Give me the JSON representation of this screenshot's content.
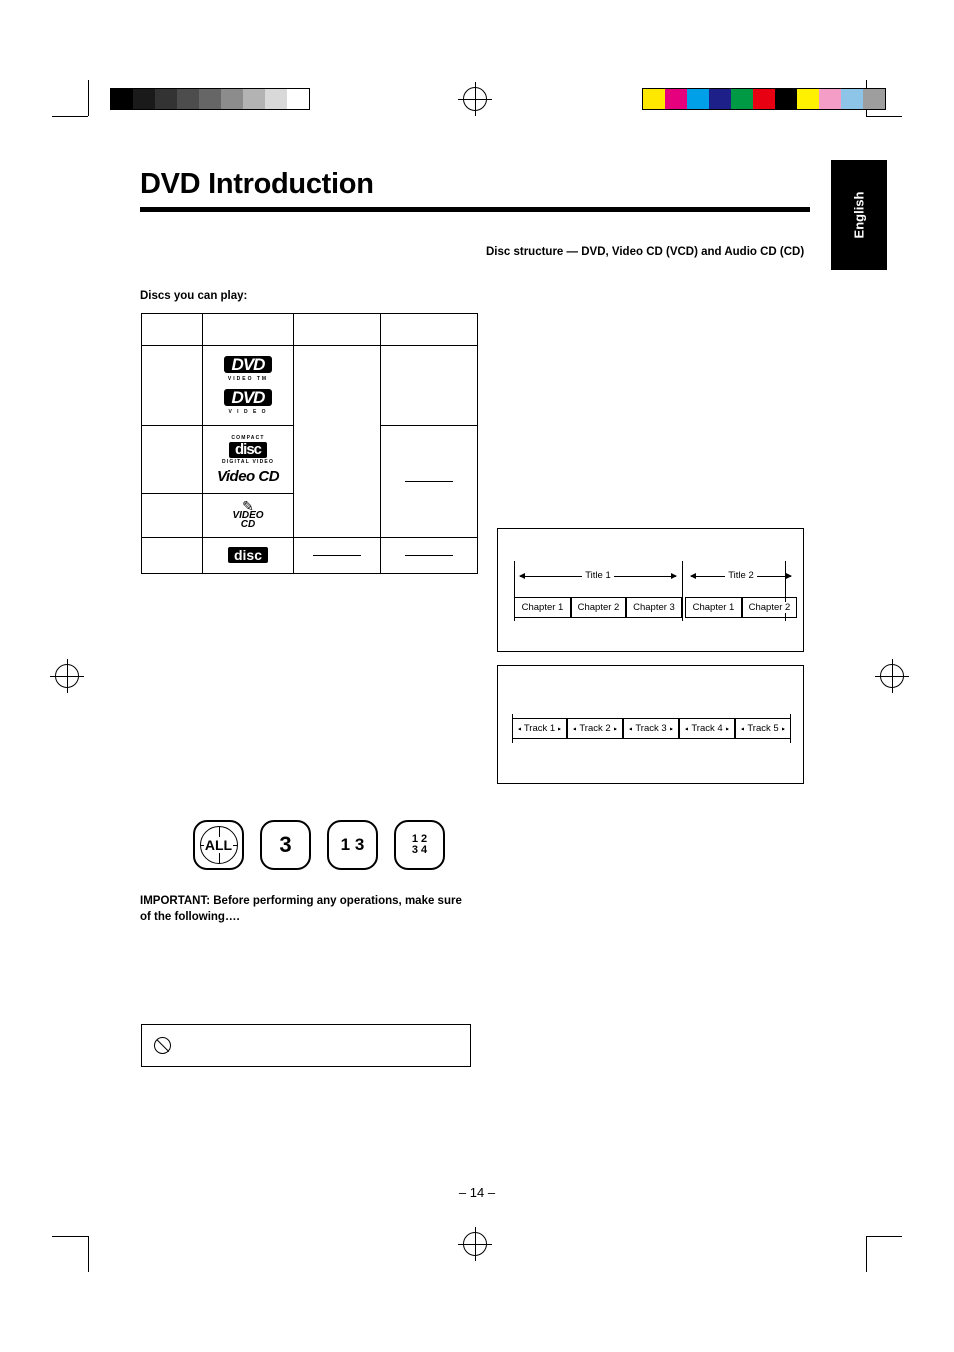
{
  "document": {
    "title": "DVD Introduction",
    "language_tab": "English",
    "page_number": "– 14 –"
  },
  "left_column": {
    "discs_heading": "Discs you can play:",
    "disc_table": {
      "rows": [
        {
          "logos": [
            "DVD",
            "DVD"
          ],
          "logo_sub": [
            "VIDEO TM",
            "V I D E O"
          ]
        },
        {
          "logos": [
            "COMPACT disc DIGITAL VIDEO",
            "Video CD"
          ]
        },
        {
          "logos": [
            "VIDEO CD"
          ]
        },
        {
          "logos": [
            "disc"
          ]
        }
      ]
    },
    "region_marks": [
      {
        "name": "region-all",
        "label": "ALL"
      },
      {
        "name": "region-3",
        "label": "3"
      },
      {
        "name": "region-1-3",
        "label": "1 3"
      },
      {
        "name": "region-1234",
        "label_top": "1 2",
        "label_bottom": "3 4"
      }
    ],
    "important_note": "IMPORTANT:  Before performing any operations, make sure of the following….",
    "note_box_icon": "prohibited-icon"
  },
  "right_column": {
    "structure_heading": "Disc structure — DVD, Video CD (VCD) and Audio CD (CD)",
    "dvd_diagram": {
      "name": "dvd-structure-diagram",
      "titles": [
        "Title 1",
        "Title 2"
      ],
      "chapters_title1": [
        "Chapter 1",
        "Chapter 2",
        "Chapter 3"
      ],
      "chapters_title2": [
        "Chapter 1",
        "Chapter 2"
      ]
    },
    "cd_diagram": {
      "name": "cd-structure-diagram",
      "tracks": [
        "Track 1",
        "Track 2",
        "Track 3",
        "Track 4",
        "Track 5"
      ]
    }
  },
  "print_marks": {
    "grayscale_bar": [
      "#000000",
      "#1a1a1a",
      "#333333",
      "#4d4d4d",
      "#666666",
      "#8c8c8c",
      "#b3b3b3",
      "#d9d9d9",
      "#ffffff"
    ],
    "color_bar": [
      "#ffe800",
      "#e6007e",
      "#00a0e9",
      "#1d2088",
      "#009944",
      "#e60012",
      "#000000",
      "#fff100",
      "#f39dc7",
      "#8cc5e8",
      "#9e9e9f"
    ]
  }
}
